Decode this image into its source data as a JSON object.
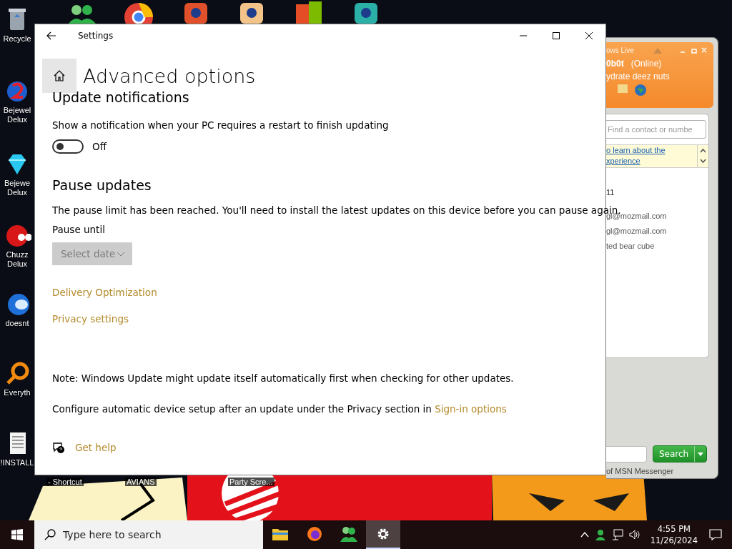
{
  "desktop": {
    "left_icons": [
      {
        "label": "Recycle"
      },
      {
        "label": "Bejewel Delux"
      },
      {
        "label": "Bejewe Delux"
      },
      {
        "label": "Chuzz Delux"
      },
      {
        "label": "doesnt"
      },
      {
        "label": "Everyth"
      },
      {
        "label": "!INSTALL"
      }
    ],
    "bottom_labels": [
      {
        "label": "- Shortcut"
      },
      {
        "label": "AVIANS"
      },
      {
        "label": "Party Scre..."
      }
    ]
  },
  "messenger": {
    "header": {
      "title": "ows Live",
      "name": "0b0t",
      "status": "(Online)",
      "message": "ydrate deez nuts"
    },
    "search": {
      "placeholder": "Find a contact or numbe"
    },
    "banner": {
      "lines": [
        "o learn about the",
        "xperience"
      ]
    },
    "contacts": [
      "11",
      "gl@mozmail.com",
      "gl@mozmail.com",
      "ted bear cube"
    ],
    "search_button": "Search",
    "footer": "of MSN Messenger"
  },
  "settings": {
    "window": {
      "title": "Settings"
    },
    "page_title": "Advanced options",
    "update_notifications": {
      "heading": "Update notifications",
      "description": "Show a notification when your PC requires a restart to finish updating",
      "toggle": {
        "on": false,
        "label": "Off"
      }
    },
    "pause_updates": {
      "heading": "Pause updates",
      "description": "The pause limit has been reached. You'll need to install the latest updates on this device before you can pause again.",
      "field_label": "Pause until",
      "dropdown": {
        "value": "Select date",
        "disabled": true
      }
    },
    "links": [
      "Delivery Optimization",
      "Privacy settings"
    ],
    "note": "Note: Windows Update might update itself automatically first when checking for other updates.",
    "configure": {
      "text": "Configure automatic device setup after an update under the Privacy section in",
      "link": "Sign-in options"
    },
    "help": "Get help"
  },
  "taskbar": {
    "search": {
      "placeholder": "Type here to search"
    },
    "apps": [
      {
        "kind": "folder",
        "selected": false
      },
      {
        "kind": "browser",
        "selected": false
      },
      {
        "kind": "messenger",
        "selected": false
      },
      {
        "kind": "settings",
        "selected": true
      }
    ],
    "time": "4:55 PM",
    "date": "11/26/2024"
  }
}
